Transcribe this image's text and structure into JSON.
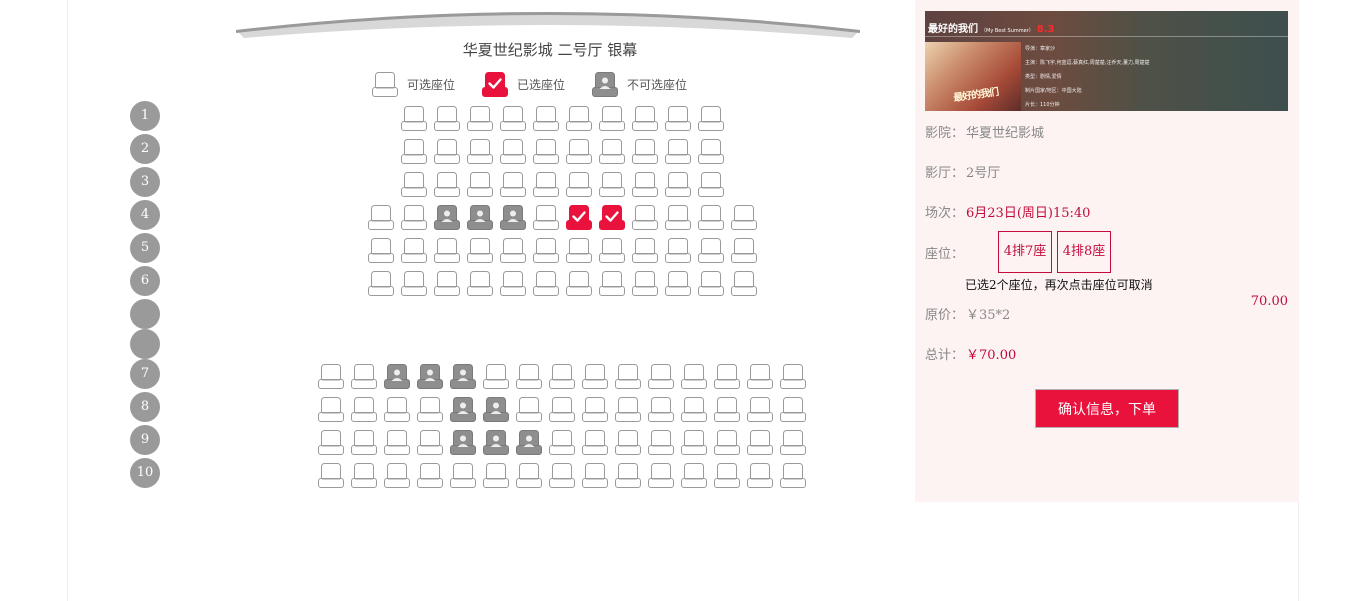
{
  "hall": {
    "title": "华夏世纪影城  二号厅 银幕"
  },
  "legend": {
    "available": "可选座位",
    "selected": "已选座位",
    "unavailable": "不可选座位"
  },
  "row_badges": [
    "1",
    "2",
    "3",
    "4",
    "5",
    "6",
    "",
    "",
    "7",
    "8",
    "9",
    "10"
  ],
  "seat_map": {
    "upper_block": [
      [
        "available",
        "available",
        "available",
        "available",
        "available",
        "available",
        "available",
        "available",
        "available",
        "available"
      ],
      [
        "available",
        "available",
        "available",
        "available",
        "available",
        "available",
        "available",
        "available",
        "available",
        "available"
      ],
      [
        "available",
        "available",
        "available",
        "available",
        "available",
        "available",
        "available",
        "available",
        "available",
        "available"
      ],
      [
        "available",
        "available",
        "unavailable",
        "unavailable",
        "unavailable",
        "available",
        "selected",
        "selected",
        "available",
        "available",
        "available",
        "available"
      ],
      [
        "available",
        "available",
        "available",
        "available",
        "available",
        "available",
        "available",
        "available",
        "available",
        "available",
        "available",
        "available"
      ],
      [
        "available",
        "available",
        "available",
        "available",
        "available",
        "available",
        "available",
        "available",
        "available",
        "available",
        "available",
        "available"
      ]
    ],
    "lower_block": [
      [
        "available",
        "available",
        "unavailable",
        "unavailable",
        "unavailable",
        "available",
        "available",
        "available",
        "available",
        "available",
        "available",
        "available",
        "available",
        "available",
        "available"
      ],
      [
        "available",
        "available",
        "available",
        "available",
        "unavailable",
        "unavailable",
        "available",
        "available",
        "available",
        "available",
        "available",
        "available",
        "available",
        "available",
        "available"
      ],
      [
        "available",
        "available",
        "available",
        "available",
        "unavailable",
        "unavailable",
        "unavailable",
        "available",
        "available",
        "available",
        "available",
        "available",
        "available",
        "available",
        "available"
      ],
      [
        "available",
        "available",
        "available",
        "available",
        "available",
        "available",
        "available",
        "available",
        "available",
        "available",
        "available",
        "available",
        "available",
        "available",
        "available"
      ]
    ]
  },
  "movie": {
    "title": "最好的我们",
    "title_en": "（My Best Summer）",
    "rating": "8.3",
    "poster_art_text": "最好的我们",
    "details": [
      "导演：章家沙",
      "主演：陈飞宇,何蓝逗,蔡真红,周楚楚,汪乔天,董力,周楚楚",
      "类型：剧情,爱情",
      "制片国家/地区：中国大陆",
      "片长：110分钟"
    ]
  },
  "order": {
    "cinema_label": "影院：",
    "cinema_value": "华夏世纪影城",
    "hall_label": "影厅：",
    "hall_value": "2号厅",
    "session_label": "场次：",
    "session_value": "6月23日(周日)15:40",
    "seat_label": "座位：",
    "selected_seats": [
      "4排7座",
      "4排8座"
    ],
    "hint": "已选2个座位，再次点击座位可取消",
    "subtotal": "70.00",
    "original_label": "原价：",
    "original_value": "￥35*2",
    "total_label": "总计：",
    "total_value": "￥70.00",
    "confirm_label": "确认信息，下单"
  },
  "colors": {
    "accent": "#e8123d",
    "text_red": "#c20c3b",
    "seat_unavailable": "#8e8e8e",
    "panel_bg": "#fdf3f3",
    "row_badge": "#9a9a9a"
  }
}
